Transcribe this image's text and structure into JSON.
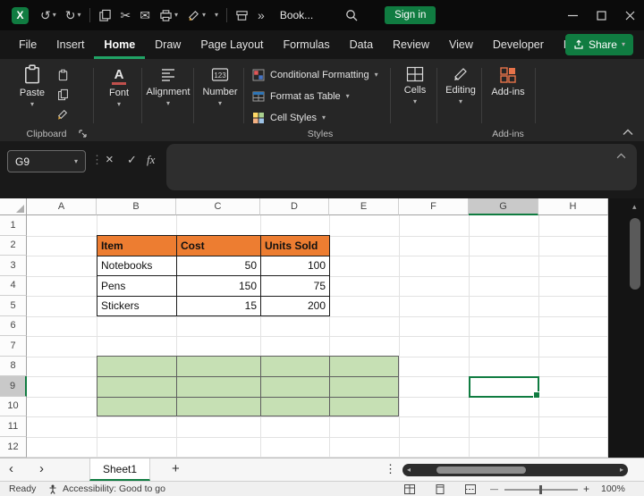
{
  "colors": {
    "accent_green": "#107C41",
    "table_header_orange": "#ED7D31",
    "range_fill_green": "#C6E0B4",
    "selection_border": "#107C41"
  },
  "icons": {
    "excel_logo": "X",
    "undo": "↺",
    "redo": "↻",
    "caret_down": "▾",
    "scissors": "✂",
    "envelope": "✉",
    "overflow": "»",
    "dots_vertical": "⋮",
    "cancel": "×",
    "enter": "✓",
    "fx": "fx",
    "tab_prev": "‹",
    "tab_next": "›",
    "add_sheet": "+",
    "scroll_left": "◂",
    "scroll_right": "▸",
    "scroll_up": "▴",
    "zoom_minus": "—",
    "zoom_plus": "+"
  },
  "titlebar": {
    "document_title": "Book...",
    "sign_in_label": "Sign in"
  },
  "ribbon_tabs": {
    "items": [
      "File",
      "Insert",
      "Home",
      "Draw",
      "Page Layout",
      "Formulas",
      "Data",
      "Review",
      "View",
      "Developer",
      "Help"
    ],
    "selected": "Home",
    "share_label": "Share"
  },
  "ribbon": {
    "paste": "Paste",
    "font": "Font",
    "alignment": "Alignment",
    "number": "Number",
    "conditional_formatting": "Conditional Formatting",
    "format_as_table": "Format as Table",
    "cell_styles": "Cell Styles",
    "cells": "Cells",
    "editing": "Editing",
    "addins": "Add-ins",
    "groups": {
      "clipboard": "Clipboard",
      "styles": "Styles",
      "addins": "Add-ins"
    }
  },
  "formula_bar": {
    "name_box": "G9"
  },
  "sheet": {
    "columns": [
      "A",
      "B",
      "C",
      "D",
      "E",
      "F",
      "G",
      "H"
    ],
    "rows": [
      "1",
      "2",
      "3",
      "4",
      "5",
      "6",
      "7",
      "8",
      "9",
      "10",
      "11",
      "12"
    ],
    "selected_column": "G",
    "selected_row": "9",
    "active_cell": "G9"
  },
  "sheet_data": {
    "table": {
      "range": "B2:D5",
      "headers": [
        "Item",
        "Cost",
        "Units Sold"
      ],
      "rows": [
        [
          "Notebooks",
          50,
          100
        ],
        [
          "Pens",
          150,
          75
        ],
        [
          "Stickers",
          15,
          200
        ]
      ]
    },
    "filled_range": {
      "range": "B8:E10",
      "fill": "#C6E0B4"
    }
  },
  "tabs_bar": {
    "active_sheet": "Sheet1"
  },
  "status_bar": {
    "ready": "Ready",
    "accessibility": "Accessibility: Good to go",
    "zoom": "100%"
  }
}
